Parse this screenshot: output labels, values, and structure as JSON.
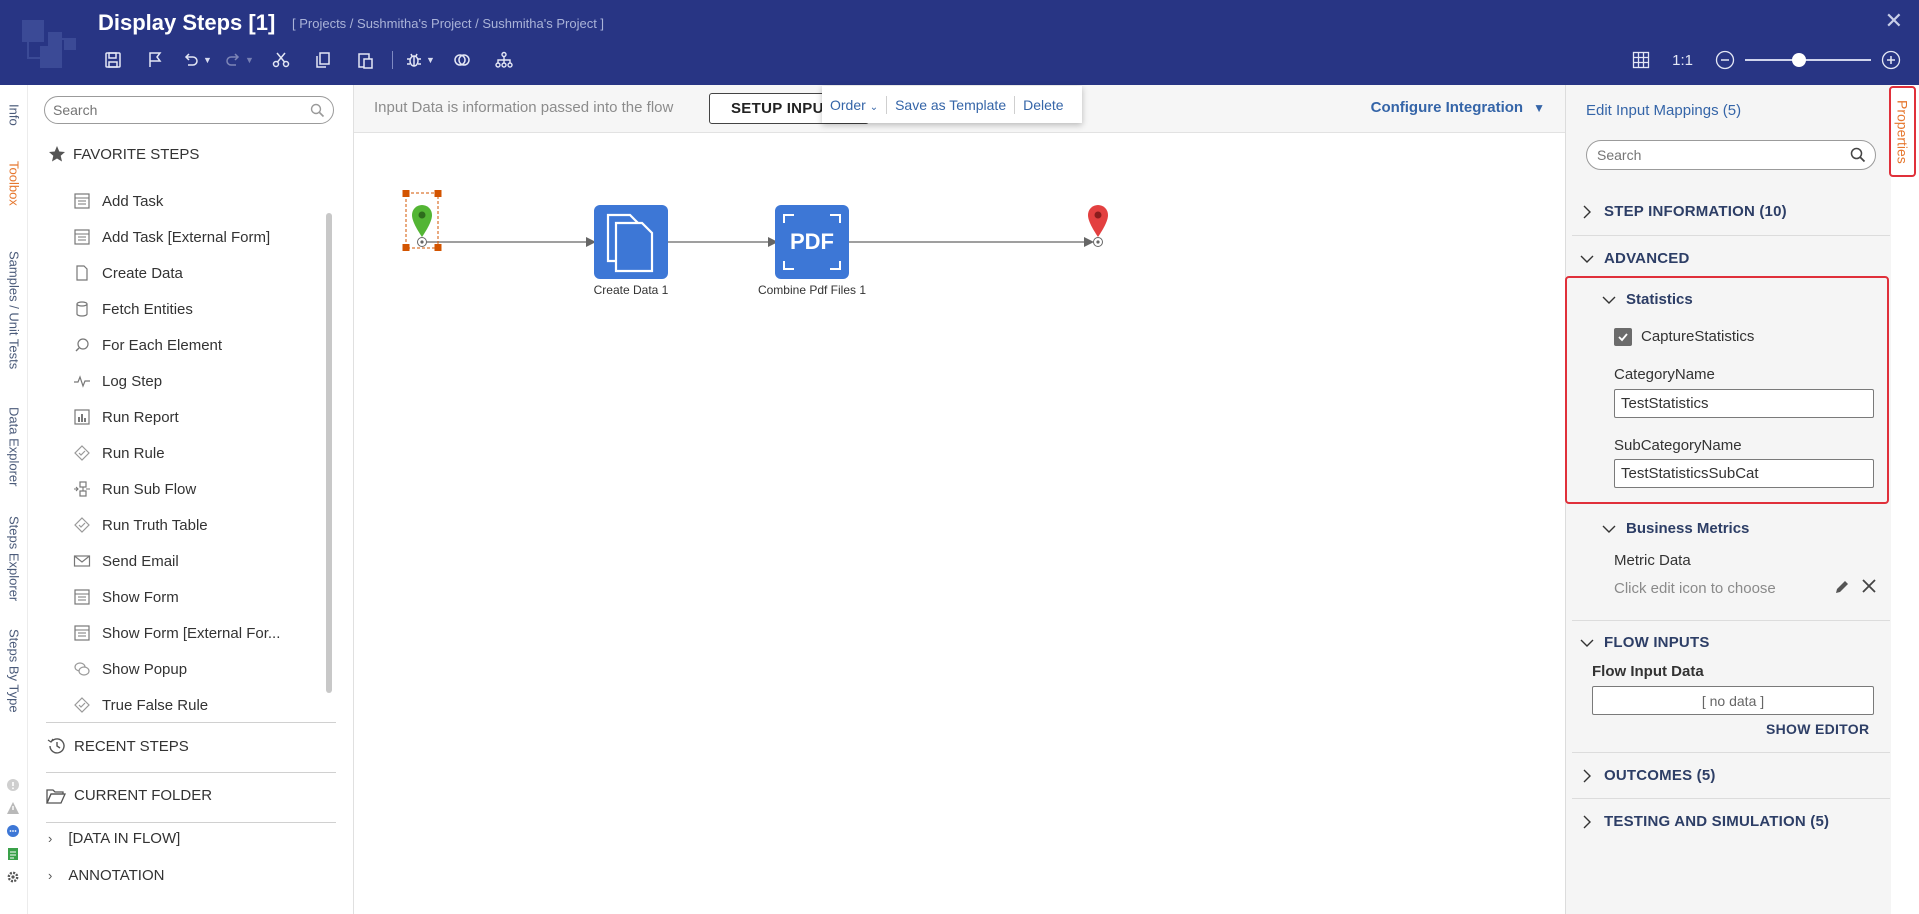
{
  "header": {
    "title": "Display Steps [1]",
    "breadcrumb": "[ Projects / Sushmitha's Project / Sushmitha's Project ]",
    "close": "✕",
    "zoom_ratio": "1:1",
    "zoom_level": 0.43
  },
  "left_rail": {
    "tabs": [
      "Info",
      "Toolbox",
      "Samples / Unit Tests",
      "Data Explorer",
      "Steps Explorer",
      "Steps By Type"
    ],
    "active_tab": "Toolbox"
  },
  "toolbox": {
    "search_placeholder": "Search",
    "favorites_title": "FAVORITE STEPS",
    "steps": [
      {
        "label": "Add Task",
        "icon": "form-icon"
      },
      {
        "label": "Add Task [External Form]",
        "icon": "form-icon"
      },
      {
        "label": "Create Data",
        "icon": "document-icon"
      },
      {
        "label": "Fetch Entities",
        "icon": "database-icon"
      },
      {
        "label": "For Each Element",
        "icon": "loop-icon"
      },
      {
        "label": "Log Step",
        "icon": "pulse-icon"
      },
      {
        "label": "Run Report",
        "icon": "report-icon"
      },
      {
        "label": "Run Rule",
        "icon": "rule-icon"
      },
      {
        "label": "Run Sub Flow",
        "icon": "subflow-icon"
      },
      {
        "label": "Run Truth Table",
        "icon": "rule-icon"
      },
      {
        "label": "Send Email",
        "icon": "envelope-icon"
      },
      {
        "label": "Show Form",
        "icon": "form-icon"
      },
      {
        "label": "Show Form [External For...",
        "icon": "form-icon"
      },
      {
        "label": "Show Popup",
        "icon": "popup-icon"
      },
      {
        "label": "True False Rule",
        "icon": "rule-icon"
      }
    ],
    "recent_steps": "RECENT STEPS",
    "current_folder": "CURRENT FOLDER",
    "data_in_flow": "[DATA IN FLOW]",
    "annotation": "ANNOTATION"
  },
  "canvas": {
    "input_note": "Input Data is information passed into the flow",
    "setup_button": "SETUP INPUTS",
    "configure_integration": "Configure Integration",
    "context_menu": {
      "order": "Order",
      "save_template": "Save as Template",
      "delete": "Delete"
    },
    "nodes": {
      "create_data": "Create Data 1",
      "combine_pdf": "Combine Pdf Files 1",
      "pdf_text": "PDF"
    }
  },
  "properties": {
    "header": "Edit Input Mappings (5)",
    "search_placeholder": "Search",
    "step_information": "STEP INFORMATION (10)",
    "advanced": "ADVANCED",
    "statistics": "Statistics",
    "capture_statistics": "CaptureStatistics",
    "capture_checked": true,
    "category_name_label": "CategoryName",
    "category_name_value": "TestStatistics",
    "subcategory_name_label": "SubCategoryName",
    "subcategory_name_value": "TestStatisticsSubCat",
    "business_metrics": "Business Metrics",
    "metric_data_label": "Metric Data",
    "metric_hint": "Click edit icon to choose",
    "flow_inputs": "FLOW INPUTS",
    "flow_input_data_label": "Flow Input Data",
    "flow_input_data_value": "[ no data ]",
    "show_editor": "SHOW EDITOR",
    "outcomes": "OUTCOMES (5)",
    "testing": "TESTING AND SIMULATION (5)"
  },
  "right_tab": "Properties",
  "colors": {
    "header_bg": "#283584",
    "accent_blue": "#3565a8",
    "node_blue": "#3d77d6",
    "start_green": "#53b534",
    "end_red": "#e34040",
    "highlight_red": "#e0303a",
    "active_orange": "#e6772e"
  }
}
